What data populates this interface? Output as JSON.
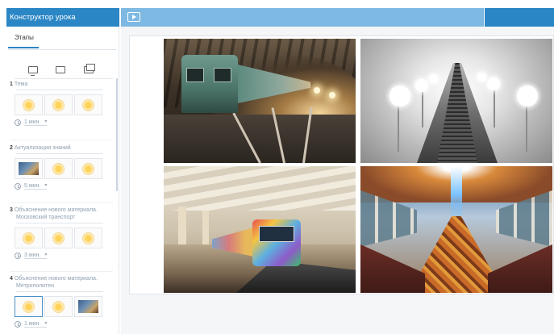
{
  "app": {
    "title": "Конструктор урока"
  },
  "header": {
    "play_icon": "play-icon"
  },
  "sidebar": {
    "tabs": [
      {
        "label": "Этапы"
      }
    ],
    "view_icons": [
      "desktop-icon",
      "tablet-icon",
      "multi-window-icon"
    ],
    "stages": [
      {
        "num": "1",
        "title": "Тема",
        "subtitle": "",
        "thumbs": [
          "sun",
          "sun",
          "sun"
        ],
        "duration": "1 мин."
      },
      {
        "num": "2",
        "title": "Актуализация знаний",
        "subtitle": "",
        "thumbs": [
          "photo",
          "sun",
          "sun"
        ],
        "duration": "5 мин."
      },
      {
        "num": "3",
        "title": "Объяснение нового материала.",
        "subtitle": "Московский транспорт",
        "thumbs": [
          "sun",
          "sun",
          "sun"
        ],
        "duration": "3 мин."
      },
      {
        "num": "4",
        "title": "Объяснение нового материала.",
        "subtitle": "Метрополитен",
        "thumbs": [
          "sun",
          "sun",
          "photo"
        ],
        "duration": "1 мин."
      }
    ]
  },
  "slide": {
    "photos": [
      "metro-tunnel-train",
      "metro-escalator",
      "metro-platform-train",
      "decorated-train-interior"
    ]
  },
  "colors": {
    "primary": "#2b86c5",
    "header_mid": "#7db9e2",
    "active_border": "#4a90c8"
  }
}
